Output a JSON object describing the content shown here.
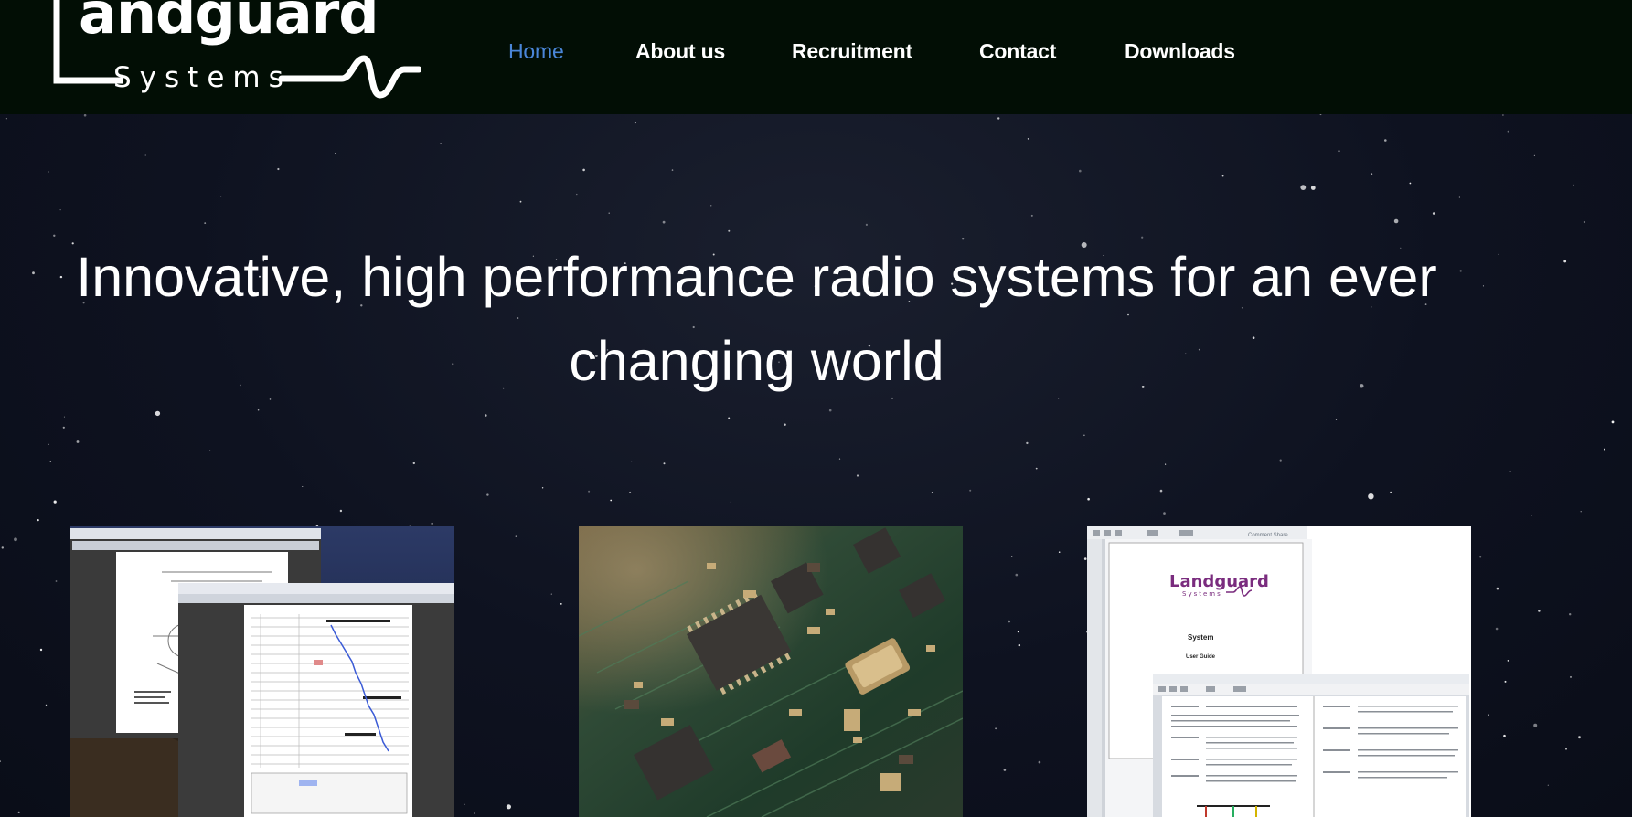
{
  "brand": {
    "logo_word": "andguard",
    "logo_sub": "Systems"
  },
  "nav": {
    "items": [
      {
        "label": "Home",
        "active": true
      },
      {
        "label": "About us",
        "active": false
      },
      {
        "label": "Recruitment",
        "active": false
      },
      {
        "label": "Contact",
        "active": false
      },
      {
        "label": "Downloads",
        "active": false
      }
    ]
  },
  "hero": {
    "headline": "Innovative, high performance radio systems for an ever changing world"
  },
  "cards": [
    {
      "image": "project-planning-screenshots-image"
    },
    {
      "image": "circuit-board-image"
    },
    {
      "image": "user-guide-documents-image",
      "doc_logo_word": "Landguard",
      "doc_logo_sub": "Systems",
      "doc_title": "System",
      "doc_subtitle": "User Guide",
      "toolbar_label": "Comment   Share"
    }
  ],
  "colors": {
    "header_bg": "#020e05",
    "nav_active": "#4a86d8",
    "nav_text": "#ffffff",
    "hero_bg": "#0e1220",
    "doc_logo": "#7a2c7e"
  }
}
